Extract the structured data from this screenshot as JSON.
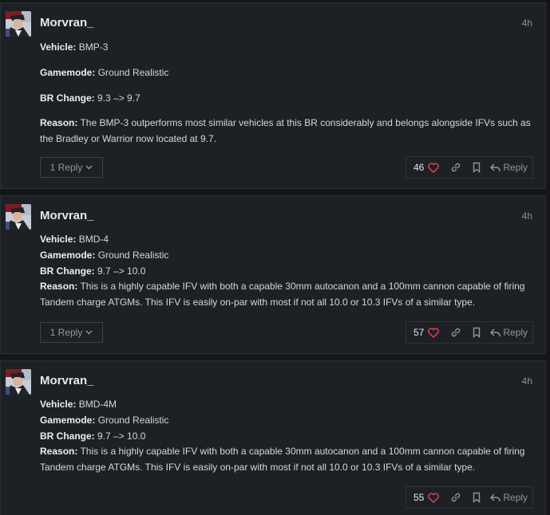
{
  "posts": [
    {
      "username": "Morvran_",
      "time": "4h",
      "vehicle_label": "Vehicle:",
      "vehicle": " BMP-3",
      "gamemode_label": "Gamemode:",
      "gamemode": " Ground Realistic",
      "br_label": "BR Change:",
      "br": " 9.3 –> 9.7",
      "reason_label": "Reason:",
      "reason": " The BMP-3 outperforms most similar vehicles at this BR considerably and belongs alongside IFVs such as the Bradley or Warrior now located at 9.7.",
      "replies_label": "1 Reply",
      "likes": "46",
      "reply_label": "Reply"
    },
    {
      "username": "Morvran_",
      "time": "4h",
      "vehicle_label": "Vehicle:",
      "vehicle": " BMD-4",
      "gamemode_label": "Gamemode:",
      "gamemode": " Ground Realistic",
      "br_label": "BR Change:",
      "br": " 9.7 –> 10.0",
      "reason_label": "Reason:",
      "reason": " This is a highly capable IFV with both a capable 30mm autocanon and a 100mm cannon capable of firing Tandem charge ATGMs. This IFV is easily on-par with most if not all 10.0 or 10.3 IFVs of a similar type.",
      "replies_label": "1 Reply",
      "likes": "57",
      "reply_label": "Reply"
    },
    {
      "username": "Morvran_",
      "time": "4h",
      "vehicle_label": "Vehicle:",
      "vehicle": " BMD-4M",
      "gamemode_label": "Gamemode:",
      "gamemode": " Ground Realistic",
      "br_label": "BR Change:",
      "br": " 9.7 –> 10.0",
      "reason_label": "Reason:",
      "reason": " This is a highly capable IFV with both a capable 30mm autocanon and a 100mm cannon capable of firing Tandem charge ATGMs. This IFV is easily on-par with most if not all 10.0 or 10.3 IFVs of a similar type.",
      "likes": "55",
      "reply_label": "Reply"
    }
  ],
  "icons": {
    "heart": "heart-icon",
    "link": "link-icon",
    "bookmark": "bookmark-icon",
    "reply": "reply-arrow-icon",
    "chevron": "chevron-down-icon"
  },
  "colors": {
    "heart": "#e0434b",
    "card_bg": "#1d2126"
  }
}
